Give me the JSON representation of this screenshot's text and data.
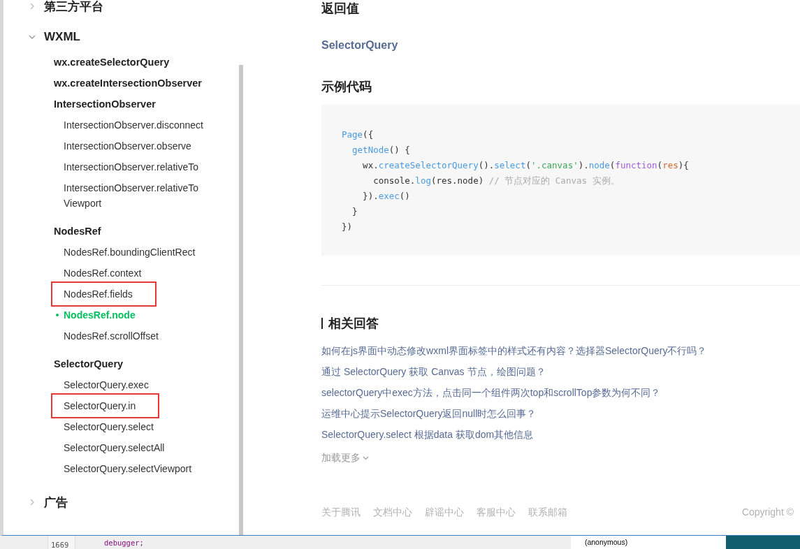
{
  "sidebar": {
    "items": [
      {
        "label": "第三方平台",
        "expanded": false
      },
      {
        "label": "WXML",
        "expanded": true,
        "children": [
          {
            "label": "wx.createSelectorQuery",
            "selected": false,
            "highlighted": false
          },
          {
            "label": "wx.createIntersectionObserver",
            "selected": false,
            "highlighted": false
          },
          {
            "label": "IntersectionObserver",
            "selected": false,
            "highlighted": false,
            "children": [
              {
                "label": "IntersectionObserver.disconnect",
                "selected": false,
                "highlighted": false
              },
              {
                "label": "IntersectionObserver.observe",
                "selected": false,
                "highlighted": false
              },
              {
                "label": "IntersectionObserver.relativeTo",
                "selected": false,
                "highlighted": false
              },
              {
                "label": "IntersectionObserver.relativeToViewport",
                "selected": false,
                "highlighted": false
              }
            ]
          },
          {
            "label": "NodesRef",
            "selected": false,
            "highlighted": false,
            "children": [
              {
                "label": "NodesRef.boundingClientRect",
                "selected": false,
                "highlighted": false
              },
              {
                "label": "NodesRef.context",
                "selected": false,
                "highlighted": false
              },
              {
                "label": "NodesRef.fields",
                "selected": false,
                "highlighted": true
              },
              {
                "label": "NodesRef.node",
                "selected": true,
                "highlighted": false
              },
              {
                "label": "NodesRef.scrollOffset",
                "selected": false,
                "highlighted": false
              }
            ]
          },
          {
            "label": "SelectorQuery",
            "selected": false,
            "highlighted": false,
            "children": [
              {
                "label": "SelectorQuery.exec",
                "selected": false,
                "highlighted": false
              },
              {
                "label": "SelectorQuery.in",
                "selected": false,
                "highlighted": true
              },
              {
                "label": "SelectorQuery.select",
                "selected": false,
                "highlighted": false
              },
              {
                "label": "SelectorQuery.selectAll",
                "selected": false,
                "highlighted": false
              },
              {
                "label": "SelectorQuery.selectViewport",
                "selected": false,
                "highlighted": false
              }
            ]
          }
        ]
      },
      {
        "label": "广告",
        "expanded": false
      }
    ]
  },
  "content": {
    "return_heading": "返回值",
    "return_type": "SelectorQuery",
    "example_heading": "示例代码",
    "code": [
      [
        {
          "text": "Page",
          "kind": "fn"
        },
        {
          "text": "({",
          "kind": "plain"
        }
      ],
      [
        {
          "text": "  getNode",
          "kind": "fn"
        },
        {
          "text": "() {",
          "kind": "plain"
        }
      ],
      [
        {
          "text": "    wx.",
          "kind": "plain"
        },
        {
          "text": "createSelectorQuery",
          "kind": "fn"
        },
        {
          "text": "().",
          "kind": "plain"
        },
        {
          "text": "select",
          "kind": "fn"
        },
        {
          "text": "(",
          "kind": "plain"
        },
        {
          "text": "'.canvas'",
          "kind": "str"
        },
        {
          "text": ").",
          "kind": "plain"
        },
        {
          "text": "node",
          "kind": "fn"
        },
        {
          "text": "(",
          "kind": "plain"
        },
        {
          "text": "function",
          "kind": "kw"
        },
        {
          "text": "(",
          "kind": "plain"
        },
        {
          "text": "res",
          "kind": "param"
        },
        {
          "text": "){",
          "kind": "plain"
        }
      ],
      [
        {
          "text": "      console.",
          "kind": "plain"
        },
        {
          "text": "log",
          "kind": "fn"
        },
        {
          "text": "(res.node) ",
          "kind": "plain"
        },
        {
          "text": "// 节点对应的 Canvas 实例。",
          "kind": "comment"
        }
      ],
      [
        {
          "text": "    }).",
          "kind": "plain"
        },
        {
          "text": "exec",
          "kind": "fn"
        },
        {
          "text": "()",
          "kind": "plain"
        }
      ],
      [
        {
          "text": "  }",
          "kind": "plain"
        }
      ],
      [
        {
          "text": "})",
          "kind": "plain"
        }
      ]
    ],
    "related": {
      "heading": "相关回答",
      "links": [
        "如何在js界面中动态修改wxml界面标签中的样式还有内容？选择器SelectorQuery不行吗？",
        "通过 SelectorQuery 获取 Canvas 节点，绘图问题？",
        "selectorQuery中exec方法，点击同一个组件两次top和scrollTop参数为何不同？",
        "运维中心提示SelectorQuery返回null时怎么回事？",
        "SelectorQuery.select 根据data 获取dom其他信息"
      ],
      "more": "加载更多"
    },
    "footer": {
      "links": [
        "关于腾讯",
        "文档中心",
        "辟谣中心",
        "客服中心",
        "联系邮箱"
      ],
      "copyright": "Copyright ©"
    }
  },
  "background": {
    "line_number": "1669",
    "code": "debugger;",
    "call_stack": "(anonymous)"
  }
}
